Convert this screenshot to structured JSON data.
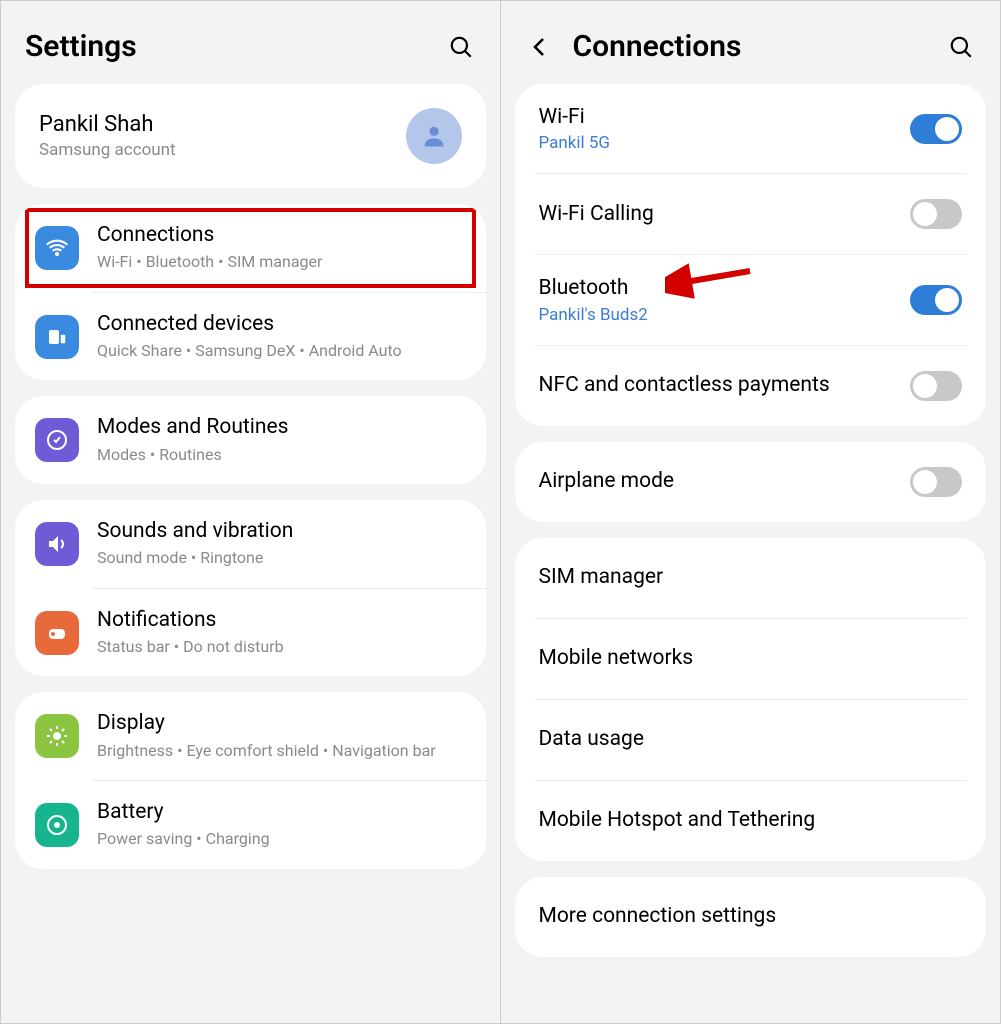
{
  "left": {
    "title": "Settings",
    "account": {
      "name": "Pankil Shah",
      "sub": "Samsung account"
    },
    "groups": [
      {
        "items": [
          {
            "icon": "wifi",
            "color": "#3a8ae0",
            "title": "Connections",
            "sub": "Wi-Fi  •  Bluetooth  •  SIM manager",
            "highlight": true
          },
          {
            "icon": "devices",
            "color": "#3a8ae0",
            "title": "Connected devices",
            "sub": "Quick Share  •  Samsung DeX  •  Android Auto"
          }
        ]
      },
      {
        "items": [
          {
            "icon": "routines",
            "color": "#6e5cd6",
            "title": "Modes and Routines",
            "sub": "Modes  •  Routines"
          }
        ]
      },
      {
        "items": [
          {
            "icon": "sound",
            "color": "#6e5cd6",
            "title": "Sounds and vibration",
            "sub": "Sound mode  •  Ringtone"
          },
          {
            "icon": "notifications",
            "color": "#e86a3a",
            "title": "Notifications",
            "sub": "Status bar  •  Do not disturb"
          }
        ]
      },
      {
        "items": [
          {
            "icon": "display",
            "color": "#8bc53f",
            "title": "Display",
            "sub": "Brightness  •  Eye comfort shield  •  Navigation bar"
          },
          {
            "icon": "battery",
            "color": "#17b58e",
            "title": "Battery",
            "sub": "Power saving  •  Charging"
          }
        ]
      }
    ]
  },
  "right": {
    "title": "Connections",
    "groups": [
      {
        "items": [
          {
            "title": "Wi-Fi",
            "sub": "Pankil 5G",
            "sublink": true,
            "toggle": true
          },
          {
            "title": "Wi-Fi Calling",
            "toggle": false
          },
          {
            "title": "Bluetooth",
            "sub": "Pankil's Buds2",
            "sublink": true,
            "toggle": true,
            "arrow": true
          },
          {
            "title": "NFC and contactless payments",
            "toggle": false
          }
        ]
      },
      {
        "items": [
          {
            "title": "Airplane mode",
            "toggle": false
          }
        ]
      },
      {
        "items": [
          {
            "title": "SIM manager"
          },
          {
            "title": "Mobile networks"
          },
          {
            "title": "Data usage"
          },
          {
            "title": "Mobile Hotspot and Tethering"
          }
        ]
      },
      {
        "items": [
          {
            "title": "More connection settings"
          }
        ]
      }
    ]
  }
}
